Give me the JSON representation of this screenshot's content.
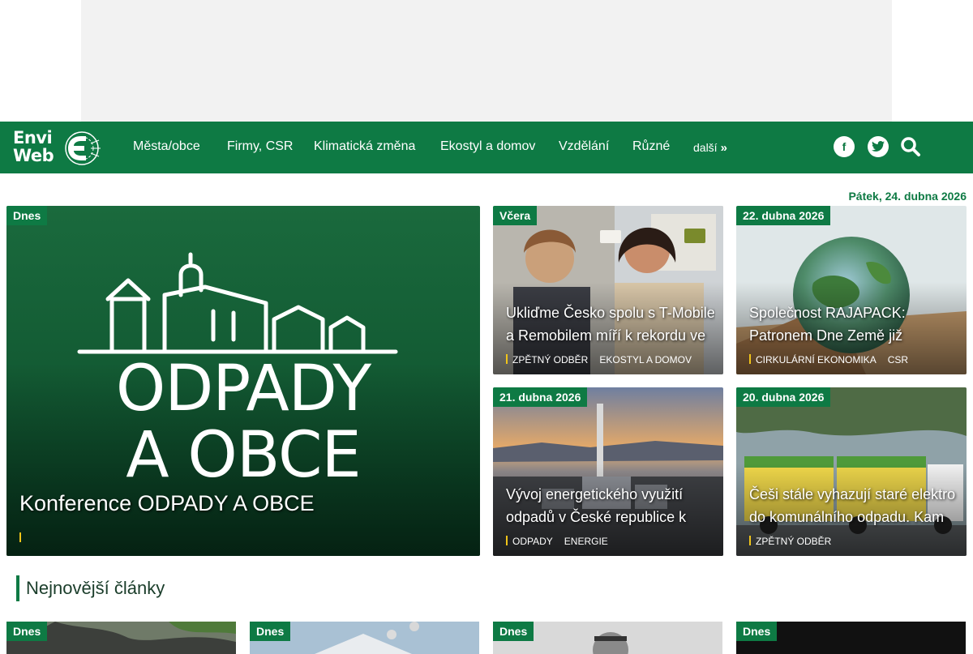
{
  "nav": {
    "logo_line1": "Envi",
    "logo_line2": "Web",
    "items": [
      "Města/obce",
      "Firmy, CSR",
      "Klimatická změna",
      "Ekostyl a domov",
      "Vzdělání",
      "Různé"
    ],
    "more_label": "další",
    "more_icon": "double-chevron-right-icon",
    "social": [
      "facebook-icon",
      "twitter-icon"
    ],
    "search_icon": "search-icon"
  },
  "current_date": "Pátek, 24. dubna 2026",
  "featured": {
    "badge": "Dnes",
    "image_text_line1": "ODPADY",
    "image_text_line2": "A OBCE",
    "title": "Konference ODPADY A OBCE",
    "tags": []
  },
  "cards": [
    {
      "badge": "Včera",
      "title": "Ukliďme Česko spolu s T-Mobile a Remobilem míří k rekordu ve",
      "tags": [
        "Zpětný odběr",
        "Ekostyl a domov"
      ]
    },
    {
      "badge": "22. dubna 2026",
      "title": "Společnost RAJAPACK: Patronem Dne Země již počtvrté",
      "tags": [
        "Cirkulární ekonomika",
        "CSR"
      ]
    },
    {
      "badge": "21. dubna 2026",
      "title": "Vývoj energetického využití odpadů v České republice k roku",
      "tags": [
        "Odpady",
        "Energie"
      ]
    },
    {
      "badge": "20. dubna 2026",
      "title": "Češi stále vyhazují staré elektro do komunálního odpadu. Kam",
      "tags": [
        "Zpětný odběr"
      ]
    }
  ],
  "latest": {
    "heading": "Nejnovější články",
    "items": [
      {
        "badge": "Dnes"
      },
      {
        "badge": "Dnes"
      },
      {
        "badge": "Dnes"
      },
      {
        "badge": "Dnes"
      }
    ]
  },
  "colors": {
    "brand_green": "#0e7a44",
    "tag_accent": "#f0c419"
  }
}
